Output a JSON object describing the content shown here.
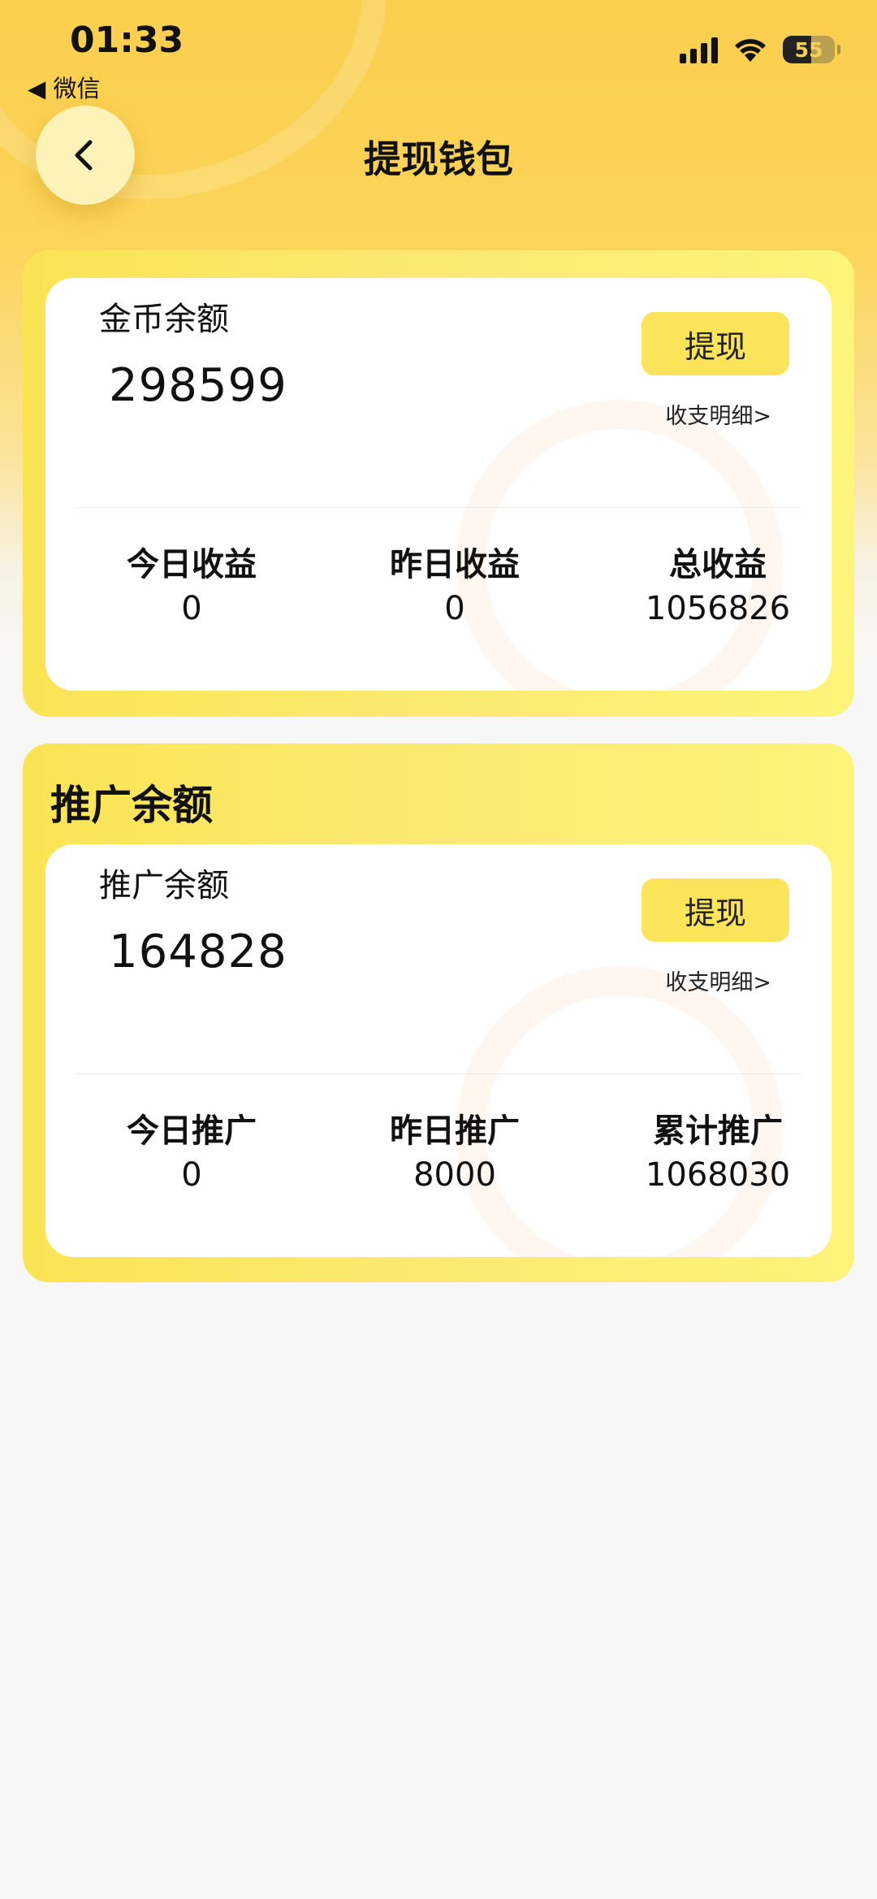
{
  "status_bar": {
    "time": "01:33",
    "back_app": "◀ 微信",
    "battery": "55"
  },
  "nav": {
    "title": "提现钱包"
  },
  "coin_card": {
    "balance_label": "金币余额",
    "balance_value": "298599",
    "withdraw_label": "提现",
    "detail_label": "收支明细>",
    "stats": [
      {
        "label": "今日收益",
        "value": "0"
      },
      {
        "label": "昨日收益",
        "value": "0"
      },
      {
        "label": "总收益",
        "value": "1056826"
      }
    ]
  },
  "promo_card": {
    "section_title": "推广余额",
    "balance_label": "推广余额",
    "balance_value": "164828",
    "withdraw_label": "提现",
    "detail_label": "收支明细>",
    "stats": [
      {
        "label": "今日推广",
        "value": "0"
      },
      {
        "label": "昨日推广",
        "value": "8000"
      },
      {
        "label": "累计推广",
        "value": "1068030"
      }
    ]
  },
  "colors": {
    "header_yellow": "#fbcf4e",
    "card_yellow": "#fbe453",
    "button_yellow": "#fbe45a",
    "background": "#f7f7f7"
  }
}
